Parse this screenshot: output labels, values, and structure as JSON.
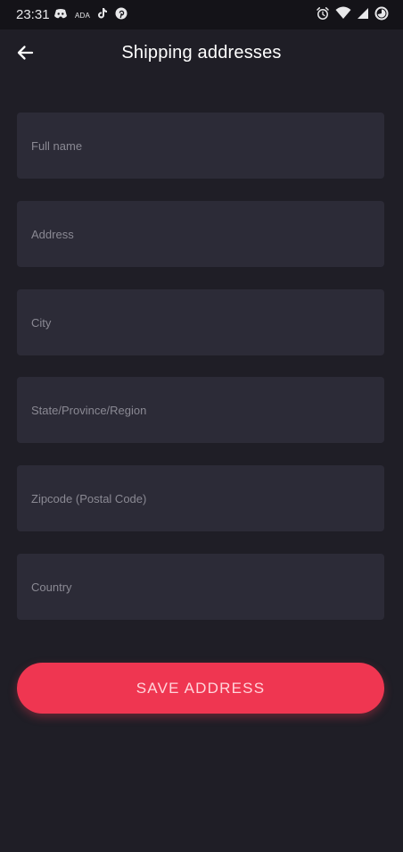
{
  "status_bar": {
    "time": "23:31",
    "left_icons": [
      "discord-icon",
      "ada-text",
      "tiktok-icon",
      "pinterest-icon"
    ],
    "ada_text": "ADA",
    "right_icons": [
      "alarm-icon",
      "wifi-icon",
      "signal-icon",
      "battery-icon"
    ]
  },
  "header": {
    "title": "Shipping addresses",
    "back_icon": "arrow-left-icon"
  },
  "form": {
    "fields": [
      {
        "name": "full-name",
        "placeholder": "Full name",
        "value": ""
      },
      {
        "name": "address",
        "placeholder": "Address",
        "value": ""
      },
      {
        "name": "city",
        "placeholder": "City",
        "value": ""
      },
      {
        "name": "state",
        "placeholder": "State/Province/Region",
        "value": ""
      },
      {
        "name": "zipcode",
        "placeholder": "Zipcode (Postal Code)",
        "value": ""
      },
      {
        "name": "country",
        "placeholder": "Country",
        "value": ""
      }
    ],
    "save_label": "SAVE ADDRESS"
  },
  "colors": {
    "background": "#1f1e26",
    "field_background": "#2c2b37",
    "accent": "#ef3651",
    "placeholder": "#8a8993"
  }
}
